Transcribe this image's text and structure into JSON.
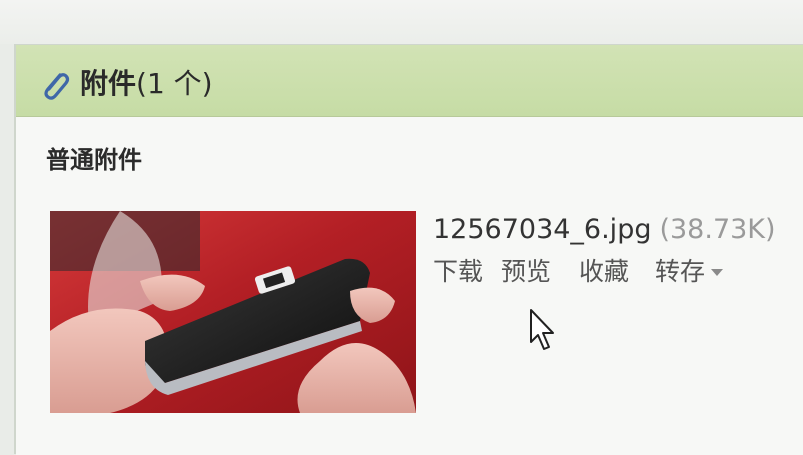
{
  "attachments": {
    "title": "附件",
    "count_text": "(1 个)",
    "section_label": "普通附件",
    "file": {
      "name": "12567034_6.jpg",
      "size": "(38.73K)",
      "thumbnail_icon": "phone-photo-thumbnail"
    },
    "actions": {
      "download": "下载",
      "preview": "预览",
      "favorite": "收藏",
      "save_to": "转存"
    },
    "icons": {
      "header": "paperclip-icon",
      "save_to_dropdown": "chevron-down-icon"
    }
  },
  "colors": {
    "header_bg": "#c6dca5",
    "panel_bg": "#f7f8f6",
    "thumbnail_bg": "#c2262a",
    "file_size": "#9a9a9a"
  }
}
